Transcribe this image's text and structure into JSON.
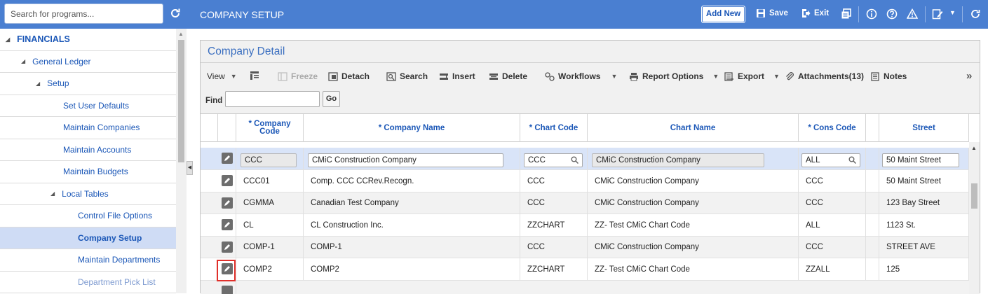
{
  "sidebar": {
    "search_placeholder": "Search for programs...",
    "items": [
      {
        "label": "FINANCIALS"
      },
      {
        "label": "General Ledger"
      },
      {
        "label": "Setup"
      },
      {
        "label": "Set User Defaults"
      },
      {
        "label": "Maintain Companies"
      },
      {
        "label": "Maintain Accounts"
      },
      {
        "label": "Maintain Budgets"
      },
      {
        "label": "Local Tables"
      },
      {
        "label": "Control File Options"
      },
      {
        "label": "Company Setup"
      },
      {
        "label": "Maintain Departments"
      },
      {
        "label": "Department Pick List"
      }
    ]
  },
  "header": {
    "title": "COMPANY SETUP",
    "add_new": "Add New",
    "save": "Save",
    "exit": "Exit"
  },
  "panel": {
    "title": "Company Detail"
  },
  "toolbar": {
    "view": "View",
    "freeze": "Freeze",
    "detach": "Detach",
    "search": "Search",
    "insert": "Insert",
    "delete": "Delete",
    "workflows": "Workflows",
    "report_options": "Report Options",
    "export": "Export",
    "attachments": "Attachments(13)",
    "notes": "Notes",
    "find_label": "Find",
    "go": "Go"
  },
  "grid": {
    "columns": {
      "company_code": "* Company Code",
      "company_name": "* Company Name",
      "chart_code": "* Chart Code",
      "chart_name": "Chart Name",
      "cons_code": "* Cons Code",
      "street": "Street"
    },
    "rows": [
      {
        "company_code": "CCC",
        "company_name": "CMiC Construction Company",
        "chart_code": "CCC",
        "chart_name": "CMiC Construction Company",
        "cons_code": "ALL",
        "street": "50 Maint Street"
      },
      {
        "company_code": "CCC01",
        "company_name": "Comp. CCC CCRev.Recogn.",
        "chart_code": "CCC",
        "chart_name": "CMiC Construction Company",
        "cons_code": "CCC",
        "street": "50 Maint Street"
      },
      {
        "company_code": "CGMMA",
        "company_name": "Canadian Test Company",
        "chart_code": "CCC",
        "chart_name": "CMiC Construction Company",
        "cons_code": "CCC",
        "street": "123 Bay Street"
      },
      {
        "company_code": "CL",
        "company_name": "CL Construction Inc.",
        "chart_code": "ZZCHART",
        "chart_name": "ZZ- Test CMiC Chart Code",
        "cons_code": "ALL",
        "street": "1123 St."
      },
      {
        "company_code": "COMP-1",
        "company_name": "COMP-1",
        "chart_code": "CCC",
        "chart_name": "CMiC Construction Company",
        "cons_code": "CCC",
        "street": "STREET AVE"
      },
      {
        "company_code": "COMP2",
        "company_name": "COMP2",
        "chart_code": "ZZCHART",
        "chart_name": "ZZ- Test CMiC Chart Code",
        "cons_code": "ZZALL",
        "street": "125"
      }
    ]
  }
}
